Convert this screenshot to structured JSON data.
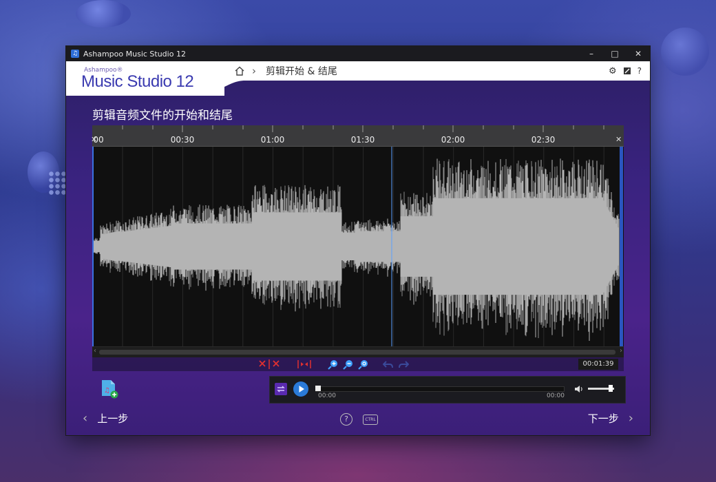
{
  "window": {
    "title": "Ashampoo Music Studio 12"
  },
  "logo": {
    "small": "Ashampoo®",
    "big": "Music Studio 12"
  },
  "breadcrumb": {
    "current": "剪辑开始 & 结尾"
  },
  "header_icons": {
    "help": "?"
  },
  "page": {
    "title": "剪辑音频文件的开始和结尾"
  },
  "timeline": {
    "labels": [
      "00",
      "00:30",
      "01:00",
      "01:30",
      "02:00",
      "02:30"
    ]
  },
  "editor": {
    "position_time": "00:01:39"
  },
  "player": {
    "current": "00:00",
    "total": "00:00"
  },
  "footer": {
    "prev": "上一步",
    "next": "下一步",
    "help": "?",
    "ctrl": "CTRL"
  },
  "colors": {
    "accent": "#2a7ad8",
    "cut": "#e03030",
    "zoom": "#3fa0ff",
    "wave": "#b4b4b4"
  }
}
